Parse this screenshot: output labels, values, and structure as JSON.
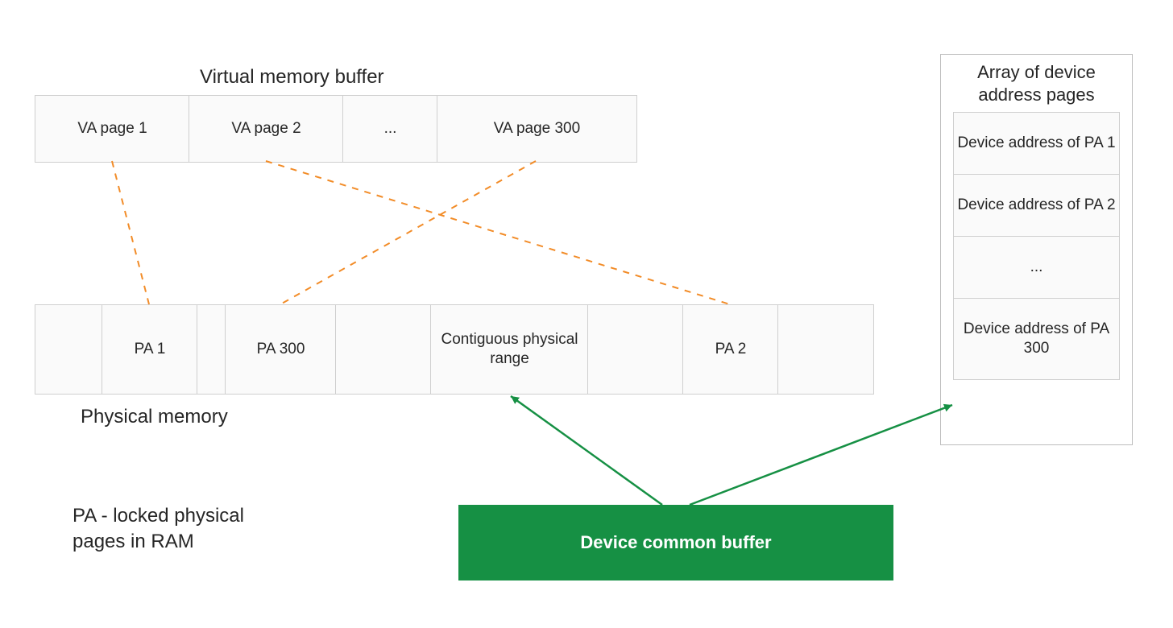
{
  "titles": {
    "vm": "Virtual memory buffer",
    "pm": "Physical memory",
    "device_array": "Array of device address pages",
    "legend": "PA - locked physical pages in RAM",
    "dcb": "Device common buffer"
  },
  "vm_pages": [
    "VA page 1",
    "VA page 2",
    "...",
    "VA page 300"
  ],
  "pm_cells": [
    "",
    "PA 1",
    "",
    "PA 300",
    "",
    "Contiguous physical range",
    "",
    "PA 2",
    ""
  ],
  "device_array": [
    "Device address of PA 1",
    "Device address of PA 2",
    "...",
    "Device address of PA 300"
  ],
  "colors": {
    "orange": "#F28C28",
    "green": "#169044"
  }
}
